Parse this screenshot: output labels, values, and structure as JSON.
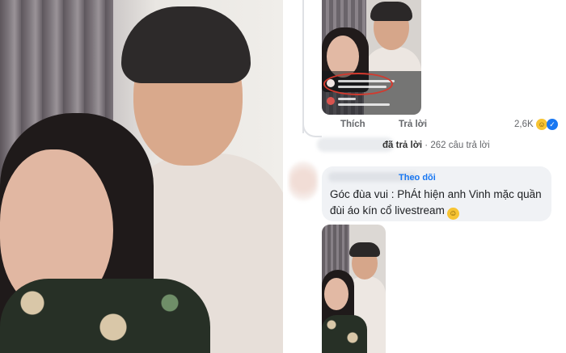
{
  "comment_actions": {
    "like_label": "Thích",
    "reply_label": "Trả lời",
    "reaction_count": "2,6K",
    "reactions": [
      "haha",
      "like"
    ]
  },
  "replies_summary": {
    "replied_text": "đã trả lời",
    "separator": "·",
    "reply_count_text": "262 câu trả lời"
  },
  "reply_comment": {
    "follow_label": "Theo dõi",
    "text": "Góc đùa vui : PhÁt hiện anh Vinh mặc quần đùi áo kín cổ livestream",
    "emoji": "laughing-face"
  },
  "colors": {
    "link_blue": "#1877f2",
    "bubble_bg": "#f0f2f5",
    "meta_gray": "#65676b",
    "highlight_ring": "#d23a2e"
  }
}
